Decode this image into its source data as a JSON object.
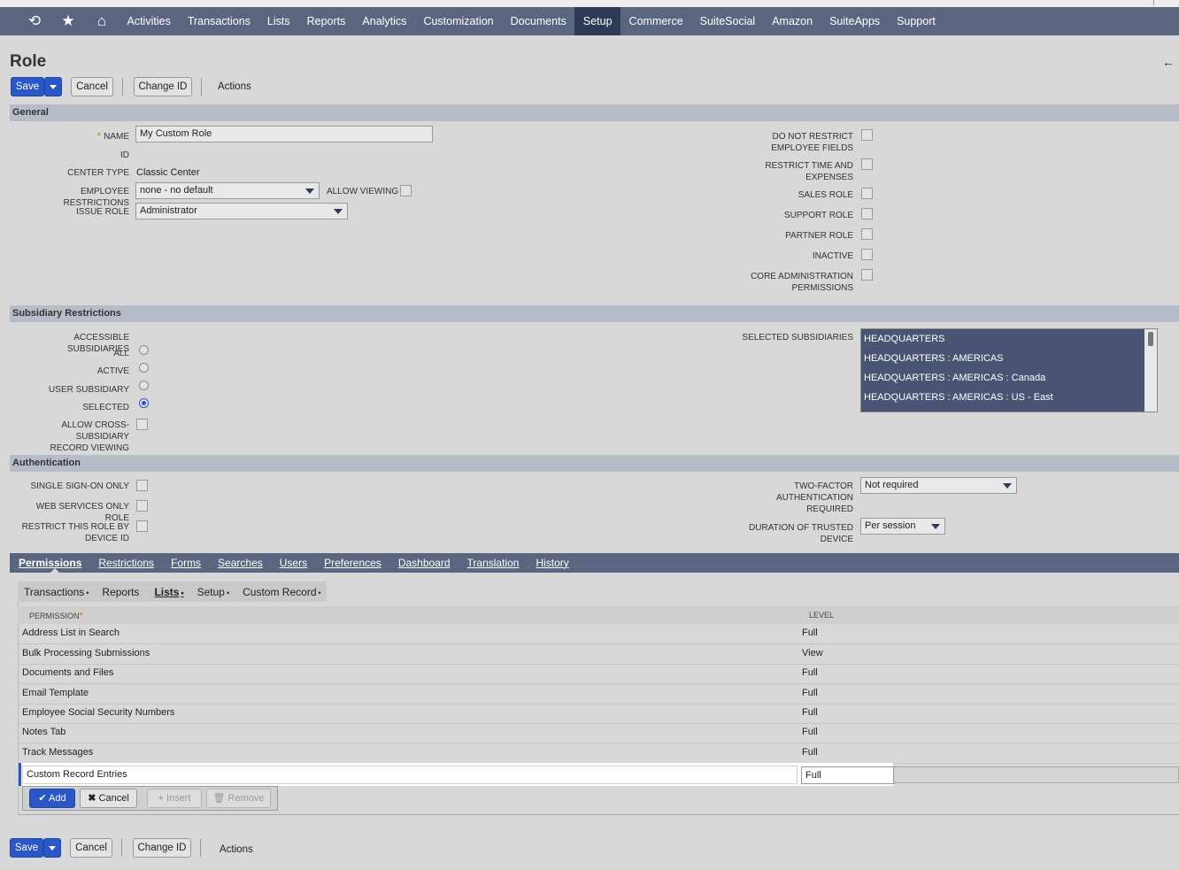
{
  "nav": {
    "items": [
      "Activities",
      "Transactions",
      "Lists",
      "Reports",
      "Analytics",
      "Customization",
      "Documents",
      "Setup",
      "Commerce",
      "SuiteSocial",
      "Amazon",
      "SuiteApps",
      "Support"
    ],
    "active": "Setup"
  },
  "page": {
    "title": "Role",
    "back_icon": "←"
  },
  "toolbar": {
    "save": "Save",
    "cancel": "Cancel",
    "change_id": "Change ID",
    "actions": "Actions"
  },
  "general": {
    "header": "General",
    "name_label": "NAME",
    "name_value": "My Custom Role",
    "id_label": "ID",
    "center_type_label": "CENTER TYPE",
    "center_type_value": "Classic Center",
    "employee_restrictions_label": "EMPLOYEE RESTRICTIONS",
    "employee_restrictions_value": "none - no default",
    "allow_viewing_label": "ALLOW VIEWING",
    "issue_role_label": "ISSUE ROLE",
    "issue_role_value": "Administrator",
    "right": {
      "do_not_restrict_1": "DO NOT RESTRICT",
      "do_not_restrict_2": "EMPLOYEE FIELDS",
      "restrict_time_1": "RESTRICT TIME AND",
      "restrict_time_2": "EXPENSES",
      "sales_role": "SALES ROLE",
      "support_role": "SUPPORT ROLE",
      "partner_role": "PARTNER ROLE",
      "inactive": "INACTIVE",
      "core_admin_1": "CORE ADMINISTRATION",
      "core_admin_2": "PERMISSIONS"
    }
  },
  "subsidiary": {
    "header": "Subsidiary Restrictions",
    "accessible_label": "ACCESSIBLE SUBSIDIARIES",
    "all": "ALL",
    "active": "ACTIVE",
    "user_subsidiary": "USER SUBSIDIARY",
    "selected": "SELECTED",
    "cross_1": "ALLOW CROSS-SUBSIDIARY",
    "cross_2": "RECORD VIEWING",
    "selected_label": "SELECTED SUBSIDIARIES",
    "selected_list": [
      "HEADQUARTERS",
      "HEADQUARTERS : AMERICAS",
      "HEADQUARTERS : AMERICAS : Canada",
      "HEADQUARTERS : AMERICAS : US - East"
    ]
  },
  "auth": {
    "header": "Authentication",
    "sso": "SINGLE SIGN-ON ONLY",
    "web_services": "WEB SERVICES ONLY ROLE",
    "restrict_device_1": "RESTRICT THIS ROLE BY",
    "restrict_device_2": "DEVICE ID",
    "two_factor_1": "TWO-FACTOR",
    "two_factor_2": "AUTHENTICATION",
    "two_factor_3": "REQUIRED",
    "two_factor_value": "Not required",
    "duration_1": "DURATION OF TRUSTED",
    "duration_2": "DEVICE",
    "duration_value": "Per session"
  },
  "tabs": [
    "Permissions",
    "Restrictions",
    "Forms",
    "Searches",
    "Users",
    "Preferences",
    "Dashboard",
    "Translation",
    "History"
  ],
  "subtabs": [
    {
      "label": "Transactions",
      "dot": "•"
    },
    {
      "label": "Reports",
      "dot": ""
    },
    {
      "label": "Lists",
      "dot": "•"
    },
    {
      "label": "Setup",
      "dot": "•"
    },
    {
      "label": "Custom Record",
      "dot": "•"
    }
  ],
  "grid": {
    "col_permission": "PERMISSION",
    "col_level": "LEVEL",
    "rows": [
      {
        "permission": "Address List in Search",
        "level": "Full"
      },
      {
        "permission": "Bulk Processing Submissions",
        "level": "View"
      },
      {
        "permission": "Documents and Files",
        "level": "Full"
      },
      {
        "permission": "Email Template",
        "level": "Full"
      },
      {
        "permission": "Employee Social Security Numbers",
        "level": "Full"
      },
      {
        "permission": "Notes Tab",
        "level": "Full"
      },
      {
        "permission": "Track Messages",
        "level": "Full"
      }
    ],
    "edit_permission": "Custom Record Entries",
    "edit_level": "Full",
    "buttons": {
      "add": "Add",
      "cancel": "Cancel",
      "insert": "Insert",
      "remove": "Remove"
    }
  }
}
